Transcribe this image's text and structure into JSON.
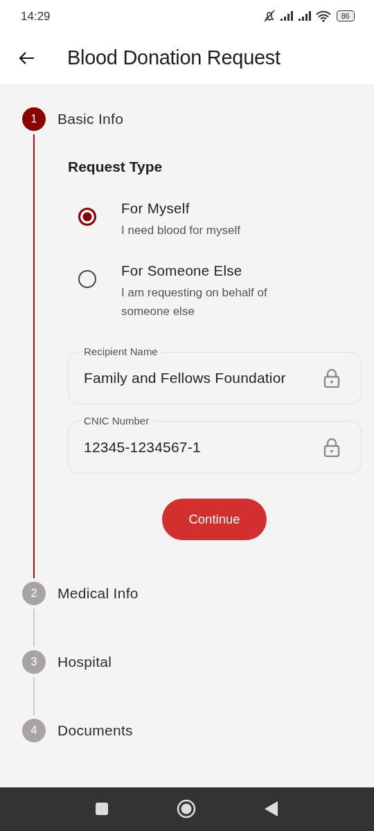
{
  "status_bar": {
    "time": "14:29",
    "battery": "86"
  },
  "app_bar": {
    "title": "Blood Donation Request"
  },
  "steps": [
    {
      "number": "1",
      "label": "Basic Info",
      "active": true
    },
    {
      "number": "2",
      "label": "Medical Info",
      "active": false
    },
    {
      "number": "3",
      "label": "Hospital",
      "active": false
    },
    {
      "number": "4",
      "label": "Documents",
      "active": false
    }
  ],
  "request_type": {
    "heading": "Request Type",
    "options": [
      {
        "title": "For Myself",
        "description": "I need blood for myself",
        "selected": true
      },
      {
        "title": "For Someone Else",
        "description": "I am requesting on behalf of someone else",
        "selected": false
      }
    ]
  },
  "fields": [
    {
      "label": "Recipient Name",
      "value": "Family and Fellows Foundatior",
      "locked": true
    },
    {
      "label": "CNIC Number",
      "value": "12345-1234567-1",
      "locked": true
    }
  ],
  "continue_button": "Continue"
}
